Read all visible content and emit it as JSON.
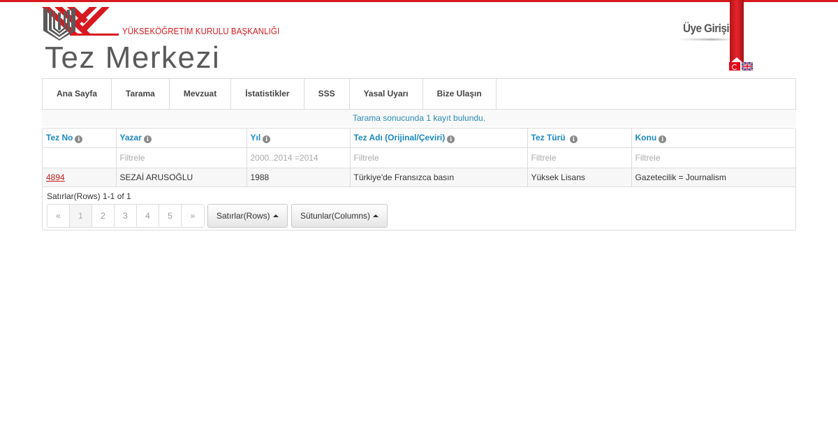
{
  "header": {
    "org_name": "YÜKSEKÖĞRETİM KURULU BAŞKANLIĞI",
    "site_title": "Tez Merkezi",
    "member_login": "Üye Girişi",
    "brand_color": "#d71920"
  },
  "nav": {
    "items": [
      {
        "label": "Ana Sayfa"
      },
      {
        "label": "Tarama"
      },
      {
        "label": "Mevzuat"
      },
      {
        "label": "İstatistikler"
      },
      {
        "label": "SSS"
      },
      {
        "label": "Yasal Uyarı"
      },
      {
        "label": "Bize Ulaşın"
      }
    ]
  },
  "result_message": "Tarama sonucunda 1 kayıt bulundu.",
  "table": {
    "columns": [
      {
        "label": "Tez No"
      },
      {
        "label": "Yazar"
      },
      {
        "label": "Yıl"
      },
      {
        "label": "Tez Adı (Orijinal/Çeviri)"
      },
      {
        "label": "Tez Türü"
      },
      {
        "label": "Konu"
      }
    ],
    "filters": {
      "yazar_placeholder": "Filtrele",
      "yil_placeholder": "2000..2014 =2014",
      "tez_adi_placeholder": "Filtrele",
      "tez_turu_placeholder": "Filtrele",
      "konu_placeholder": "Filtrele"
    },
    "rows": [
      {
        "tez_no": "4894",
        "yazar": "SEZAİ ARUSOĞLU",
        "yil": "1988",
        "tez_adi": "Türkiye'de Fransızca basın",
        "tez_turu": "Yüksek Lisans",
        "konu": "Gazetecilik = Journalism"
      }
    ]
  },
  "pagination": {
    "rows_info": "Satırlar(Rows) 1-1 of 1",
    "prev": "«",
    "pages": [
      "1",
      "2",
      "3",
      "4",
      "5"
    ],
    "next": "»",
    "rows_button": "Satırlar(Rows)",
    "columns_button": "Sütunlar(Columns)"
  }
}
